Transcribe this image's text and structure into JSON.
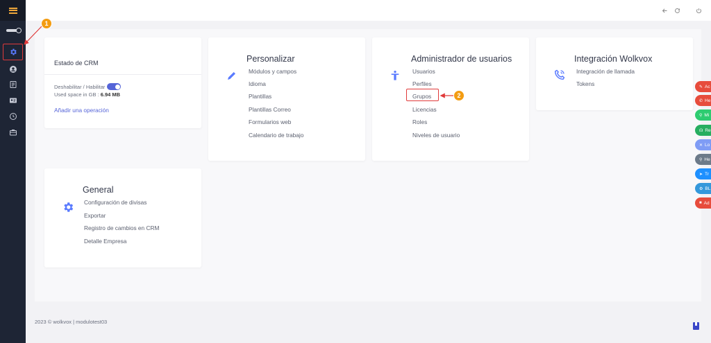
{
  "topbar": {
    "icons": [
      "back-arrow-icon",
      "refresh-icon",
      "power-icon"
    ]
  },
  "sidebar": {
    "items": [
      "settings-icon",
      "user-circle-icon",
      "list-icon",
      "contact-card-icon",
      "history-icon",
      "briefcase-icon"
    ],
    "accent": "#f0a83a",
    "active": "settings-icon"
  },
  "estado": {
    "title": "Estado de CRM",
    "toggle_label": "Deshabilitar / Habilitar",
    "space_label": "Used space in GB :",
    "space_value": "6.94 MB",
    "add_operation": "Añadir una operación"
  },
  "personalizar": {
    "title": "Personalizar",
    "links": [
      "Módulos y campos",
      "Idioma",
      "Plantillas",
      "Plantillas Correo",
      "Formularios web",
      "Calendario de trabajo"
    ]
  },
  "admin_usuarios": {
    "title": "Administrador de usuarios",
    "links": [
      "Usuarios",
      "Perfiles",
      "Grupos",
      "Licencias",
      "Roles",
      "Niveles de usuario"
    ]
  },
  "integracion": {
    "title": "Integración Wolkvox",
    "links": [
      "Integración de llamada",
      "Tokens"
    ]
  },
  "general": {
    "title": "General",
    "links": [
      "Configuración de divisas",
      "Exportar",
      "Registro de cambios en CRM",
      "Detalle Empresa"
    ]
  },
  "annotations": {
    "badge_1": "1",
    "badge_2": "2",
    "color": "#e03a3a",
    "badge_color": "#f39c12"
  },
  "side_tabs": [
    {
      "label": "Ac",
      "icon": "✎",
      "color": "#e74c3c"
    },
    {
      "label": "He",
      "icon": "✆",
      "color": "#e74c3c"
    },
    {
      "label": "Mi",
      "icon": "⚲",
      "color": "#2ecc71"
    },
    {
      "label": "Re",
      "icon": "☊",
      "color": "#27ae60"
    },
    {
      "label": "Lo",
      "icon": "✕",
      "color": "#7f9cf5"
    },
    {
      "label": "He",
      "icon": "⚲",
      "color": "#6c7a89"
    },
    {
      "label": "Tr",
      "icon": "➤",
      "color": "#1e90ff"
    },
    {
      "label": "BL",
      "icon": "⚙",
      "color": "#3498db"
    },
    {
      "label": "Ad",
      "icon": "■",
      "color": "#e74c3c"
    }
  ],
  "footer": {
    "text": "2023 © wolkvox | modulotest03"
  }
}
